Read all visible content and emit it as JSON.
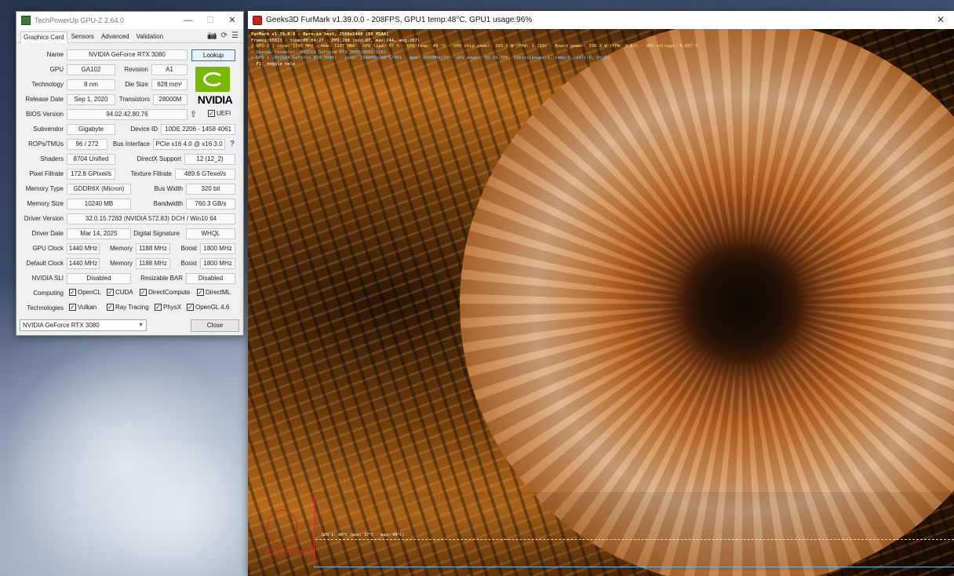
{
  "gpuz": {
    "title": "TechPowerUp GPU-Z 2.64.0",
    "window_controls": {
      "minimize": "—",
      "maximize": "☐",
      "close": "✕"
    },
    "tabs": [
      "Graphics Card",
      "Sensors",
      "Advanced",
      "Validation"
    ],
    "tab_icons": {
      "camera": "📷",
      "refresh": "⟳",
      "menu": "☰"
    },
    "labels": {
      "name": "Name",
      "gpu": "GPU",
      "revision": "Revision",
      "technology": "Technology",
      "die_size": "Die Size",
      "release_date": "Release Date",
      "transistors": "Transistors",
      "bios_version": "BIOS Version",
      "subvendor": "Subvendor",
      "device_id": "Device ID",
      "rops_tmus": "ROPs/TMUs",
      "bus_interface": "Bus Interface",
      "shaders": "Shaders",
      "directx_support": "DirectX Support",
      "pixel_fillrate": "Pixel Fillrate",
      "texture_fillrate": "Texture Fillrate",
      "memory_type": "Memory Type",
      "bus_width": "Bus Width",
      "memory_size": "Memory Size",
      "bandwidth": "Bandwidth",
      "driver_version": "Driver Version",
      "driver_date": "Driver Date",
      "digital_signature": "Digital Signature",
      "gpu_clock": "GPU Clock",
      "memory": "Memory",
      "boost": "Boost",
      "default_clock": "Default Clock",
      "nvidia_sli": "NVIDIA SLI",
      "resizable_bar": "Resizable BAR",
      "computing": "Computing",
      "technologies": "Technologies"
    },
    "values": {
      "name": "NVIDIA GeForce RTX 3080",
      "gpu": "GA102",
      "revision": "A1",
      "technology": "8 nm",
      "die_size": "628 mm²",
      "release_date": "Sep 1, 2020",
      "transistors": "28000M",
      "bios_version": "94.02.42.80.76",
      "subvendor": "Gigabyte",
      "device_id": "10DE 2206 - 1458 4061",
      "rops_tmus": "96 / 272",
      "bus_interface": "PCIe x16 4.0 @ x16 3.0",
      "shaders": "8704 Unified",
      "directx_support": "12 (12_2)",
      "pixel_fillrate": "172.8 GPixel/s",
      "texture_fillrate": "489.6 GTexel/s",
      "memory_type": "GDDR6X (Micron)",
      "bus_width": "320 bit",
      "memory_size": "10240 MB",
      "bandwidth": "760.3 GB/s",
      "driver_version": "32.0.15.7283 (NVIDIA 572.83) DCH / Win10 64",
      "driver_date": "Mar 14, 2025",
      "digital_signature": "WHQL",
      "gpu_clock": "1440 MHz",
      "gpu_clock_memory": "1188 MHz",
      "gpu_clock_boost": "1800 MHz",
      "default_clock": "1440 MHz",
      "default_clock_memory": "1188 MHz",
      "default_clock_boost": "1800 MHz",
      "nvidia_sli": "Disabled",
      "resizable_bar": "Disabled"
    },
    "lookup_button": "Lookup",
    "uefi_label": "UEFI",
    "uefi_checked": true,
    "help_icon": "?",
    "vendor_logo_text": "NVIDIA",
    "computing": [
      {
        "label": "OpenCL",
        "checked": true
      },
      {
        "label": "CUDA",
        "checked": true
      },
      {
        "label": "DirectCompute",
        "checked": true
      },
      {
        "label": "DirectML",
        "checked": true
      }
    ],
    "technologies": [
      {
        "label": "Vulkan",
        "checked": true
      },
      {
        "label": "Ray Tracing",
        "checked": true
      },
      {
        "label": "PhysX",
        "checked": true
      },
      {
        "label": "OpenGL 4.6",
        "checked": true
      }
    ],
    "gpu_select": "NVIDIA GeForce RTX 3080",
    "close_button": "Close"
  },
  "furmark": {
    "title": "Geeks3D FurMark v1.39.0.0 - 208FPS, GPU1 temp:48°C, GPU1 usage:96%",
    "close_icon": "✕",
    "overlay": [
      "FurMark v1.39.0.0 - Burn-in test, 2560x1440 (0X MSAA)",
      "Frames:55023 - time:00:04:27 - FPS:208 (min:87, max:244, avg:207)",
      "[ GPU-Z ] core: 1545 MHz - mem: 1187 MHz - GPU load: 97 % - GPU temp: 48 °C - GPU chip power: 183.6 W (PPW: 1.133) - Board power: 330.3 W (PPW: 0.63) - GPU voltage: 0.837 V",
      "> OpenGL renderer: NVIDIA GeForce RTX 3080/PCIe/SSE2",
      "> GPU 1 (NVIDIA GeForce RTX 3080) - core: 1500MHz/48°C/96% - mem: 9500MHz/7% - GPU power: 92.5% TDP, limits[power:1, temp:0, volt:0, OV:0]",
      "- F1: toggle help"
    ],
    "graph_label": "GPU 1: 48°C (min: 37°C - max: 48°C)",
    "logo_text": "FurMark"
  }
}
